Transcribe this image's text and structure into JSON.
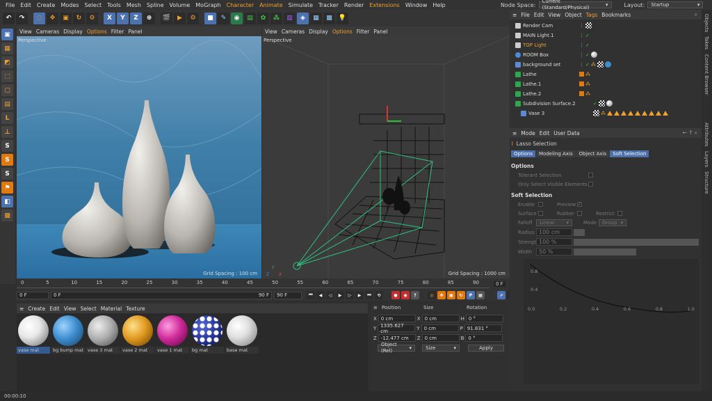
{
  "menu": [
    "File",
    "Edit",
    "Create",
    "Modes",
    "Select",
    "Tools",
    "Mesh",
    "Spline",
    "Volume",
    "MoGraph",
    "Character",
    "Animate",
    "Simulate",
    "Tracker",
    "Render",
    "Extensions",
    "Window",
    "Help"
  ],
  "node_space_label": "Node Space:",
  "node_space_value": "Current (Standard/Physical)",
  "layout_label": "Layout:",
  "layout_value": "Startup",
  "toolbar_axes": [
    "X",
    "Y",
    "Z"
  ],
  "viewport_menu": [
    "View",
    "Cameras",
    "Display",
    "Options",
    "Filter",
    "Panel"
  ],
  "viewport_left": {
    "label": "Perspective",
    "grid": "Grid Spacing : 100 cm"
  },
  "viewport_right": {
    "label": "Perspective",
    "grid": "Grid Spacing : 1000 cm"
  },
  "timeline": {
    "ticks": [
      "0",
      "5",
      "10",
      "15",
      "20",
      "25",
      "30",
      "35",
      "40",
      "45",
      "50",
      "55",
      "60",
      "65",
      "70",
      "75",
      "80",
      "85",
      "90"
    ],
    "frame_end_label": "0 F",
    "start_field": "0 F",
    "range_start": "0 F",
    "range_end": "90 F",
    "end_field": "90 F"
  },
  "material_menu": [
    "Create",
    "Edit",
    "View",
    "Select",
    "Material",
    "Texture"
  ],
  "materials": [
    {
      "name": "vase mat",
      "color": "#e8e8e8"
    },
    {
      "name": "bg bump mat",
      "color": "#3f8fd0"
    },
    {
      "name": "vase 3 mat",
      "color": "#b0b0b0"
    },
    {
      "name": "vase 2 mat",
      "color": "#e09a20"
    },
    {
      "name": "vase 1 mat",
      "color": "#d02c9a"
    },
    {
      "name": "bg mat",
      "color": "#2a3aa0"
    },
    {
      "name": "base mat",
      "color": "#e0e0e0"
    }
  ],
  "coords": {
    "headers": [
      "Position",
      "Size",
      "Rotation"
    ],
    "rows": [
      {
        "axis": "X",
        "pos": "0 cm",
        "size_axis": "X",
        "size": "0 cm",
        "rot_axis": "H",
        "rot": "0 °"
      },
      {
        "axis": "Y",
        "pos": "1335.627 cm",
        "size_axis": "Y",
        "size": "0 cm",
        "rot_axis": "P",
        "rot": "91.831 °"
      },
      {
        "axis": "Z",
        "pos": "-12.477 cm",
        "size_axis": "Z",
        "size": "0 cm",
        "rot_axis": "B",
        "rot": "0 °"
      }
    ],
    "mode_value": "Object (Rel)",
    "size_mode_value": "Size",
    "apply_label": "Apply"
  },
  "object_menu": [
    "File",
    "Edit",
    "View",
    "Object",
    "Tags",
    "Bookmarks"
  ],
  "objects": [
    {
      "name": "Render Cam",
      "color": "#ccc",
      "highlight": false
    },
    {
      "name": "MAIN Light.1",
      "color": "#ccc",
      "highlight": false
    },
    {
      "name": "TOP Light",
      "color": "#ccc",
      "highlight": true
    },
    {
      "name": "ROOM Box",
      "color": "#4a8ad8",
      "highlight": false
    },
    {
      "name": "background set",
      "color": "#5a8ad8",
      "highlight": false
    },
    {
      "name": "Lathe",
      "color": "#2aa84a",
      "highlight": false
    },
    {
      "name": "Lathe.1",
      "color": "#2aa84a",
      "highlight": false
    },
    {
      "name": "Lathe.2",
      "color": "#2aa84a",
      "highlight": false
    },
    {
      "name": "Subdivision Surface.2",
      "color": "#2aa84a",
      "highlight": false
    },
    {
      "name": "Vase 3",
      "color": "#5a8ad8",
      "highlight": false
    }
  ],
  "attr_menu": [
    "Mode",
    "Edit",
    "User Data"
  ],
  "attr_title": "Lasso Selection",
  "attr_tabs": [
    "Options",
    "Modeling Axis",
    "Object Axis",
    "Soft Selection"
  ],
  "options_section": "Options",
  "options_fields": [
    "Tolerant Selection",
    "Only Select Visible Elements"
  ],
  "soft_section": "Soft Selection",
  "soft_fields": {
    "enable": "Enable",
    "preview": "Preview",
    "surface": "Surface",
    "rubber": "Rubber",
    "restrict": "Restrict",
    "falloff": "Falloff",
    "falloff_val": "Linear",
    "mode": "Mode",
    "mode_val": "Group",
    "radius": "Radius",
    "radius_val": "100 cm",
    "strength": "Strength",
    "strength_val": "100 %",
    "width": "Width",
    "width_val": "50 %"
  },
  "graph_ticks_x": [
    "0.0",
    "0.2",
    "0.4",
    "0.6",
    "0.8",
    "1.0"
  ],
  "graph_ticks_y": [
    "0.8",
    "0.4"
  ],
  "right_tabs": [
    "Objects",
    "Takes",
    "Content Browser",
    "Attributes",
    "Layers",
    "Structure"
  ],
  "status_time": "00:00:10"
}
